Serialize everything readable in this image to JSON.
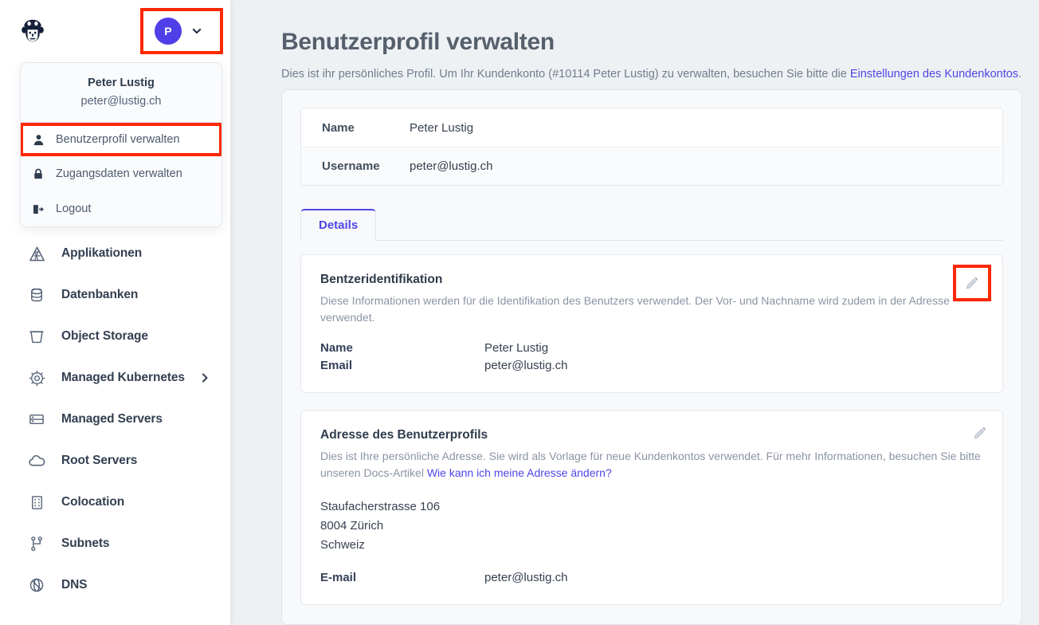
{
  "sidebar": {
    "logo_icon": "aviator-head-logo",
    "account": {
      "avatar_initial": "P",
      "chevron_icon": "chevron-down-icon"
    },
    "user_menu": {
      "name": "Peter Lustig",
      "email": "peter@lustig.ch",
      "items": [
        {
          "label": "Benutzerprofil verwalten",
          "icon": "user-icon",
          "highlighted": true
        },
        {
          "label": "Zugangsdaten verwalten",
          "icon": "lock-icon",
          "highlighted": false
        },
        {
          "label": "Logout",
          "icon": "logout-icon",
          "highlighted": false
        }
      ]
    },
    "nav_items": [
      {
        "label": "Applikationen",
        "icon": "applications-icon",
        "has_caret": false
      },
      {
        "label": "Datenbanken",
        "icon": "database-icon",
        "has_caret": false
      },
      {
        "label": "Object Storage",
        "icon": "bucket-icon",
        "has_caret": false
      },
      {
        "label": "Managed Kubernetes",
        "icon": "kubernetes-helm-icon",
        "has_caret": true
      },
      {
        "label": "Managed Servers",
        "icon": "server-rack-icon",
        "has_caret": false
      },
      {
        "label": "Root Servers",
        "icon": "cloud-icon",
        "has_caret": false
      },
      {
        "label": "Colocation",
        "icon": "building-icon",
        "has_caret": false
      },
      {
        "label": "Subnets",
        "icon": "network-nodes-icon",
        "has_caret": false
      },
      {
        "label": "DNS",
        "icon": "dns-globe-icon",
        "has_caret": false
      }
    ]
  },
  "page": {
    "title": "Benutzerprofil verwalten",
    "subtitle_before": "Dies ist ihr persönliches Profil. Um Ihr Kundenkonto (#10114 Peter Lustig) zu verwalten, besuchen Sie bitte die ",
    "subtitle_link": "Einstellungen des Kundenkontos",
    "subtitle_after": "."
  },
  "identity_table": {
    "rows": [
      {
        "key": "Name",
        "value": "Peter Lustig"
      },
      {
        "key": "Username",
        "value": "peter@lustig.ch"
      }
    ]
  },
  "tabs": [
    {
      "label": "Details",
      "active": true
    }
  ],
  "cards": {
    "identification": {
      "title": "Bentzeridentifikation",
      "description": "Diese Informationen werden für die Identifikation des Benutzers verwendet. Der Vor- und Nachname wird zudem in der Adresse verwendet.",
      "edit_icon": "pencil-icon",
      "rows": [
        {
          "key": "Name",
          "value": "Peter Lustig"
        },
        {
          "key": "Email",
          "value": "peter@lustig.ch"
        }
      ]
    },
    "address": {
      "title": "Adresse des Benutzerprofils",
      "description_before": "Dies ist Ihre persönliche Adresse. Sie wird als Vorlage für neue Kundenkontos verwendet. Für mehr Informationen, besuchen Sie bitte unseren Docs-Artikel ",
      "description_link": "Wie kann ich meine Adresse ändern?",
      "edit_icon": "pencil-icon",
      "address_lines": [
        "Staufacherstrasse 106",
        "8004 Zürich",
        "Schweiz"
      ],
      "email_row": {
        "key": "E-mail",
        "value": "peter@lustig.ch"
      }
    }
  },
  "colors": {
    "accent": "#4f46e5",
    "avatar": "#4f3fe8",
    "highlight_box": "#fb2800",
    "page_bg": "#eef1f4",
    "panel_bg": "#f8f9fa",
    "nav_text": "#333f51"
  }
}
